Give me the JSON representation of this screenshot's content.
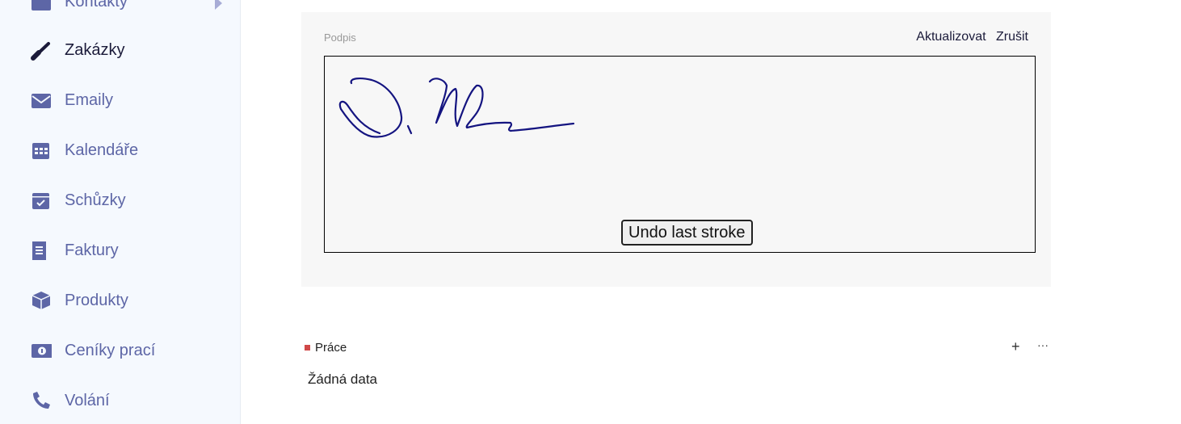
{
  "sidebar": {
    "items": [
      {
        "label": "Kontakty",
        "icon": "contact-card-icon"
      },
      {
        "label": "Zakázky",
        "icon": "screwdriver-icon",
        "active": true
      },
      {
        "label": "Emaily",
        "icon": "envelope-icon"
      },
      {
        "label": "Kalendáře",
        "icon": "calendar-icon"
      },
      {
        "label": "Schůzky",
        "icon": "calendar-check-icon"
      },
      {
        "label": "Faktury",
        "icon": "receipt-icon"
      },
      {
        "label": "Produkty",
        "icon": "box-icon"
      },
      {
        "label": "Ceníky prací",
        "icon": "money-bill-icon"
      },
      {
        "label": "Volání",
        "icon": "phone-icon"
      }
    ]
  },
  "signature": {
    "label": "Podpis",
    "update": "Aktualizovat",
    "cancel": "Zrušit",
    "undo": "Undo last stroke",
    "ink_color": "#141480"
  },
  "section": {
    "title": "Práce",
    "add": "+",
    "more": "···",
    "empty": "Žádná data",
    "marker_color": "#d04848"
  }
}
